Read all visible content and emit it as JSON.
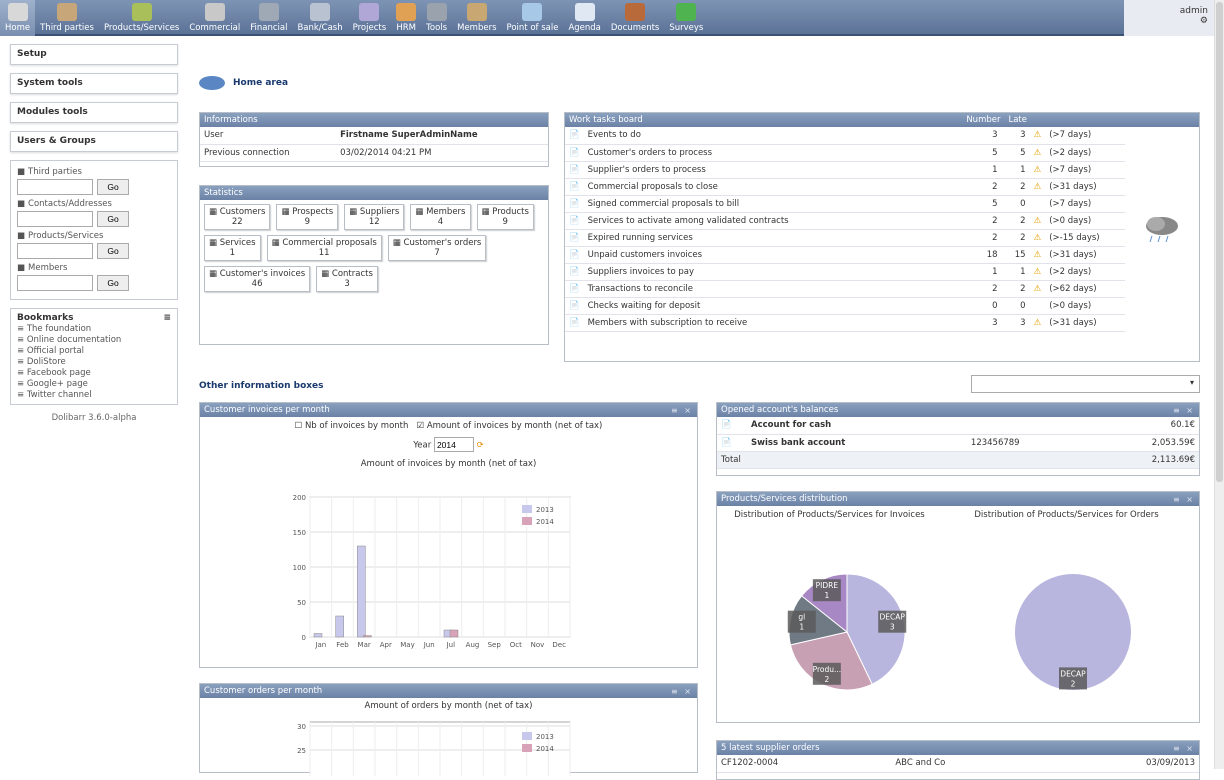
{
  "nav": [
    {
      "label": "Home",
      "color": "#d8d8d8"
    },
    {
      "label": "Third parties",
      "color": "#c7a77a"
    },
    {
      "label": "Products/Services",
      "color": "#a9c05a"
    },
    {
      "label": "Commercial",
      "color": "#c8c8c8"
    },
    {
      "label": "Financial",
      "color": "#9fa9b6"
    },
    {
      "label": "Bank/Cash",
      "color": "#b8c2d0"
    },
    {
      "label": "Projects",
      "color": "#b0a7d6"
    },
    {
      "label": "HRM",
      "color": "#e0a154"
    },
    {
      "label": "Tools",
      "color": "#9aa3ad"
    },
    {
      "label": "Members",
      "color": "#c8a772"
    },
    {
      "label": "Point of sale",
      "color": "#a8c8e8"
    },
    {
      "label": "Agenda",
      "color": "#e0e8f4"
    },
    {
      "label": "Documents",
      "color": "#b86a3a"
    },
    {
      "label": "Surveys",
      "color": "#4fb34f"
    }
  ],
  "user": {
    "name": "admin"
  },
  "left_menu": {
    "blocks": [
      "Setup",
      "System tools",
      "Modules tools",
      "Users & Groups"
    ],
    "search": [
      {
        "label": "Third parties",
        "icon": "third-parties-icon"
      },
      {
        "label": "Contacts/Addresses",
        "icon": "contacts-icon"
      },
      {
        "label": "Products/Services",
        "icon": "products-icon"
      },
      {
        "label": "Members",
        "icon": "members-icon"
      }
    ],
    "go": "Go",
    "bookmarks_title": "Bookmarks",
    "bookmarks": [
      "The foundation",
      "Online documentation",
      "Official portal",
      "DoliStore",
      "Facebook page",
      "Google+ page",
      "Twitter channel"
    ],
    "version": "Dolibarr 3.6.0-alpha"
  },
  "home_title": "Home area",
  "info": {
    "title": "Informations",
    "rows": [
      [
        "User",
        "Firstname SuperAdminName"
      ],
      [
        "Previous connection",
        "03/02/2014 04:21 PM"
      ]
    ]
  },
  "stats": {
    "title": "Statistics",
    "items": [
      [
        "Customers",
        "22"
      ],
      [
        "Prospects",
        "9"
      ],
      [
        "Suppliers",
        "12"
      ],
      [
        "Members",
        "4"
      ],
      [
        "Products",
        "9"
      ],
      [
        "Services",
        "1"
      ],
      [
        "Commercial proposals",
        "11"
      ],
      [
        "Customer's orders",
        "7"
      ],
      [
        "Customer's invoices",
        "46"
      ],
      [
        "Contracts",
        "3"
      ]
    ]
  },
  "work": {
    "title": "Work tasks board",
    "col_number": "Number",
    "col_late": "Late",
    "rows": [
      [
        "Events to do",
        "3",
        "3",
        "(>7 days)"
      ],
      [
        "Customer's orders to process",
        "5",
        "5",
        "(>2 days)"
      ],
      [
        "Supplier's orders to process",
        "1",
        "1",
        "(>7 days)"
      ],
      [
        "Commercial proposals to close",
        "2",
        "2",
        "(>31 days)"
      ],
      [
        "Signed commercial proposals to bill",
        "5",
        "0",
        "(>7 days)"
      ],
      [
        "Services to activate among validated contracts",
        "2",
        "2",
        "(>0 days)"
      ],
      [
        "Expired running services",
        "2",
        "2",
        "(>-15 days)"
      ],
      [
        "Unpaid customers invoices",
        "18",
        "15",
        "(>31 days)"
      ],
      [
        "Suppliers invoices to pay",
        "1",
        "1",
        "(>2 days)"
      ],
      [
        "Transactions to reconcile",
        "2",
        "2",
        "(>62 days)"
      ],
      [
        "Checks waiting for deposit",
        "0",
        "0",
        "(>0 days)"
      ],
      [
        "Members with subscription to receive",
        "3",
        "3",
        "(>31 days)"
      ]
    ]
  },
  "other_title": "Other information boxes",
  "inv_box": {
    "title": "Customer invoices per month",
    "opt1": "Nb of invoices by month",
    "opt2": "Amount of invoices by month (net of tax)",
    "year_label": "Year",
    "year": "2014"
  },
  "ord_box": {
    "title": "Customer orders per month"
  },
  "accounts": {
    "title": "Opened account's balances",
    "rows": [
      [
        "Account for cash",
        "",
        "60.1€"
      ],
      [
        "Swiss bank account",
        "123456789",
        "2,053.59€"
      ]
    ],
    "total_label": "Total",
    "total": "2,113.69€"
  },
  "prod_dist": {
    "title": "Products/Services distribution",
    "sub1": "Distribution of Products/Services for Invoices",
    "sub2": "Distribution of Products/Services for Orders"
  },
  "supplier_orders": {
    "title": "5 latest supplier orders",
    "row": [
      "CF1202-0004",
      "ABC and Co",
      "03/09/2013"
    ]
  },
  "chart_data": [
    {
      "type": "bar",
      "title": "Amount of invoices by month (net of tax)",
      "categories": [
        "Jan",
        "Feb",
        "Mar",
        "Apr",
        "May",
        "Jun",
        "Jul",
        "Aug",
        "Sep",
        "Oct",
        "Nov",
        "Dec"
      ],
      "series": [
        {
          "name": "2013",
          "values": [
            5,
            30,
            130,
            0,
            0,
            0,
            10,
            0,
            0,
            0,
            0,
            0
          ],
          "color": "#c8c8ec"
        },
        {
          "name": "2014",
          "values": [
            0,
            0,
            2,
            0,
            0,
            0,
            10,
            0,
            0,
            0,
            0,
            0
          ],
          "color": "#d8a3b8"
        }
      ],
      "ylim": [
        0,
        200
      ],
      "yticks": [
        0,
        50,
        100,
        150,
        200
      ]
    },
    {
      "type": "bar",
      "title": "Amount of orders by month (net of tax)",
      "series": [
        {
          "name": "2013",
          "color": "#c8c8ec"
        },
        {
          "name": "2014",
          "color": "#d8a3b8"
        }
      ],
      "yticks": [
        25,
        30
      ]
    },
    {
      "type": "pie",
      "title": "Distribution of Products/Services for Invoices",
      "slices": [
        {
          "label": "DECAP",
          "value": 3,
          "color": "#b8b6de"
        },
        {
          "label": "Produ...",
          "value": 2,
          "color": "#c8a0b4"
        },
        {
          "label": "gl",
          "value": 1,
          "color": "#707a84"
        },
        {
          "label": "PIDRE",
          "value": 1,
          "color": "#a888c4"
        }
      ]
    },
    {
      "type": "pie",
      "title": "Distribution of Products/Services for Orders",
      "slices": [
        {
          "label": "DECAP",
          "value": 2,
          "color": "#b8b6de"
        }
      ]
    }
  ]
}
